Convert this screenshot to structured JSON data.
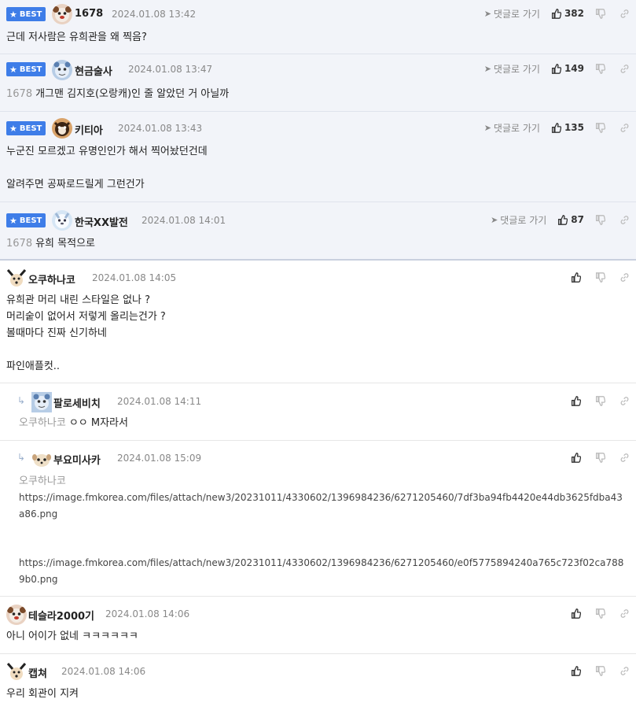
{
  "labels": {
    "best": "BEST",
    "goto": "댓글로 가기"
  },
  "best_comments": [
    {
      "nick": "1678",
      "date": "2024.01.08 13:42",
      "likes": "382",
      "text": "근데 저사람은 유희관을 왜 찍음?"
    },
    {
      "nick": "현금술사",
      "date": "2024.01.08 13:47",
      "likes": "149",
      "ref": "1678",
      "text": "개그맨 김지호(오랑캐)인 줄 알았던 거 아닐까"
    },
    {
      "nick": "키티아",
      "date": "2024.01.08 13:43",
      "likes": "135",
      "text": "누군진 모르겠고 유명인인가 해서 찍어놨던건데\n\n알려주면 공짜로드릴게 그런건가"
    },
    {
      "nick": "한국XX발전",
      "date": "2024.01.08 14:01",
      "likes": "87",
      "ref": "1678",
      "text": "유희 목적으로"
    }
  ],
  "comments": [
    {
      "nick": "오쿠하나코",
      "date": "2024.01.08 14:05",
      "text": "유희관 머리 내린 스타일은 없나 ?\n머리숱이 없어서 저렇게 올리는건가 ?\n볼때마다 진짜 신기하네\n\n파인애플컷.."
    },
    {
      "nick": "팔로세비치",
      "date": "2024.01.08 14:11",
      "ref": "오쿠하나코",
      "text": "ㅇㅇ M자라서"
    },
    {
      "nick": "부요미사카",
      "date": "2024.01.08 15:09",
      "ref": "오쿠하나코",
      "urls": [
        "https://image.fmkorea.com/files/attach/new3/20231011/4330602/1396984236/6271205460/7df3ba94fb4420e44db3625fdba43a86.png",
        "https://image.fmkorea.com/files/attach/new3/20231011/4330602/1396984236/6271205460/e0f5775894240a765c723f02ca7889b0.png"
      ]
    },
    {
      "nick": "테슬라2000기",
      "date": "2024.01.08 14:06",
      "text": "아니 어이가 없네 ㅋㅋㅋㅋㅋㅋ"
    },
    {
      "nick": "캡쳐",
      "date": "2024.01.08 14:06",
      "text": "우리 회관이 지켜"
    }
  ],
  "icons": {
    "like": "thumbs-up-icon",
    "dislike": "thumbs-down-icon",
    "link": "link-icon",
    "goto": "send-arrow-icon",
    "reply": "reply-arrow-icon"
  },
  "colors": {
    "best_badge": "#3e7de8",
    "best_bg": "#f2f4f9",
    "muted": "#888888"
  }
}
